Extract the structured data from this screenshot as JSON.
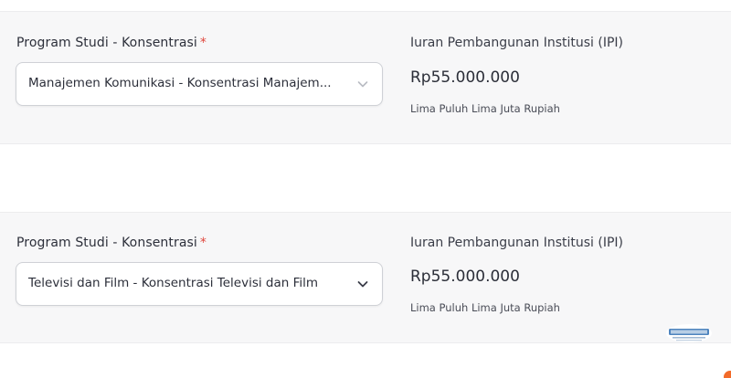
{
  "cards": [
    {
      "field_label": "Program Studi - Konsentrasi",
      "required_mark": "*",
      "selected_value": "Manajemen Komunikasi - Konsentrasi Manajem...",
      "fee_title": "Iuran Pembangunan Institusi (IPI)",
      "fee_amount": "Rp55.000.000",
      "fee_words": "Lima Puluh Lima Juta Rupiah"
    },
    {
      "field_label": "Program Studi - Konsentrasi",
      "required_mark": "*",
      "selected_value": "Televisi dan Film - Konsentrasi Televisi dan Film",
      "fee_title": "Iuran Pembangunan Institusi (IPI)",
      "fee_amount": "Rp55.000.000",
      "fee_words": "Lima Puluh Lima Juta Rupiah"
    }
  ],
  "icons": {
    "dropdown": "chevron-down-icon",
    "watermark": "watermark-logo"
  },
  "colors": {
    "required": "#e0463c",
    "card_background": "#f7f7f8",
    "accent": "#f26b2a"
  }
}
